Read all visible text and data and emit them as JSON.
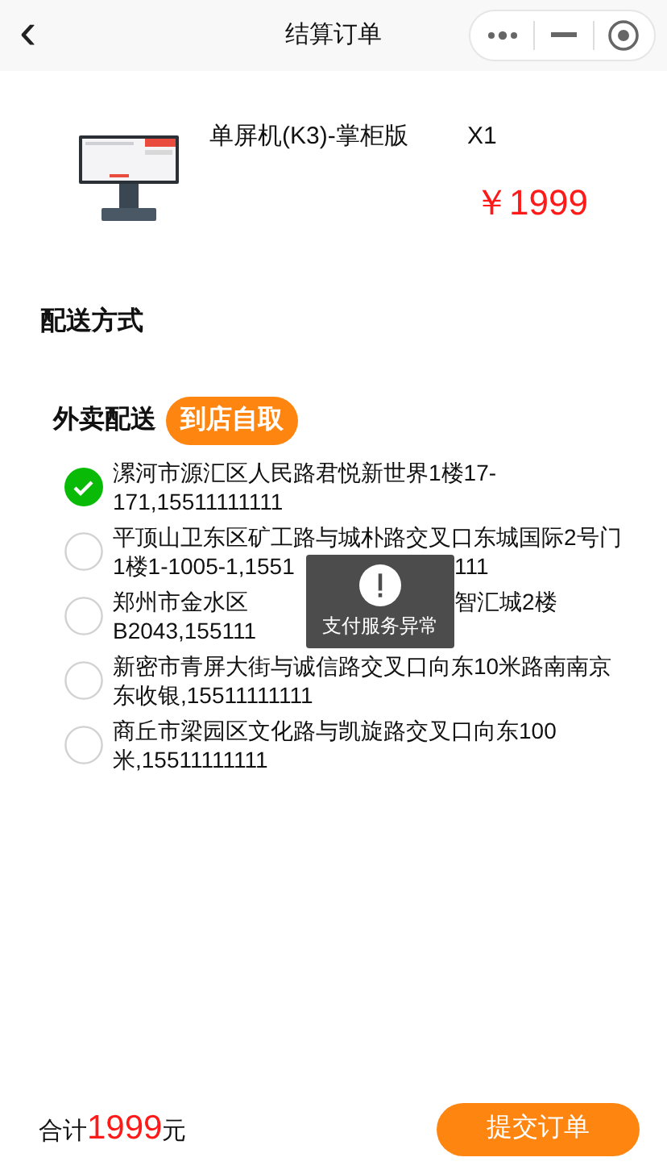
{
  "nav": {
    "back": "‹",
    "title": "结算订单"
  },
  "product": {
    "kind": "picture",
    "name": "单屏机(K3)-掌柜版",
    "quantity": "X1",
    "price": "￥1999"
  },
  "delivery": {
    "heading": "配送方式",
    "tabs": [
      {
        "label": "外卖配送",
        "selected": false
      },
      {
        "label": "到店自取",
        "selected": true
      }
    ],
    "addresses": [
      {
        "lines": [
          [
            "漯河市源汇区人民路君悦新世界1楼17-"
          ],
          [
            "171,15511111111"
          ]
        ],
        "selected": true
      },
      {
        "lines": [
          [
            "平顶山卫东区矿工路与城朴路交叉口东城国际2号门"
          ],
          [
            "1楼1-1005-1,1551",
            "111"
          ]
        ],
        "selected": false
      },
      {
        "lines": [
          [
            "郑州市金水区",
            "智汇城2楼"
          ],
          [
            "B2043,155111"
          ]
        ],
        "selected": false
      },
      {
        "lines": [
          [
            "新密市青屏大街与诚信路交叉口向东10米路南南京"
          ],
          [
            "东收银,15511111111"
          ]
        ],
        "selected": false
      },
      {
        "lines": [
          [
            "商丘市梁园区文化路与凯旋路交叉口向东100"
          ],
          [
            "米,15511111111"
          ]
        ],
        "selected": false
      }
    ]
  },
  "toast": {
    "message": "支付服务异常"
  },
  "footer": {
    "total_label": "合计",
    "total": "1999",
    "unit": "元",
    "submit": "提交订单"
  }
}
